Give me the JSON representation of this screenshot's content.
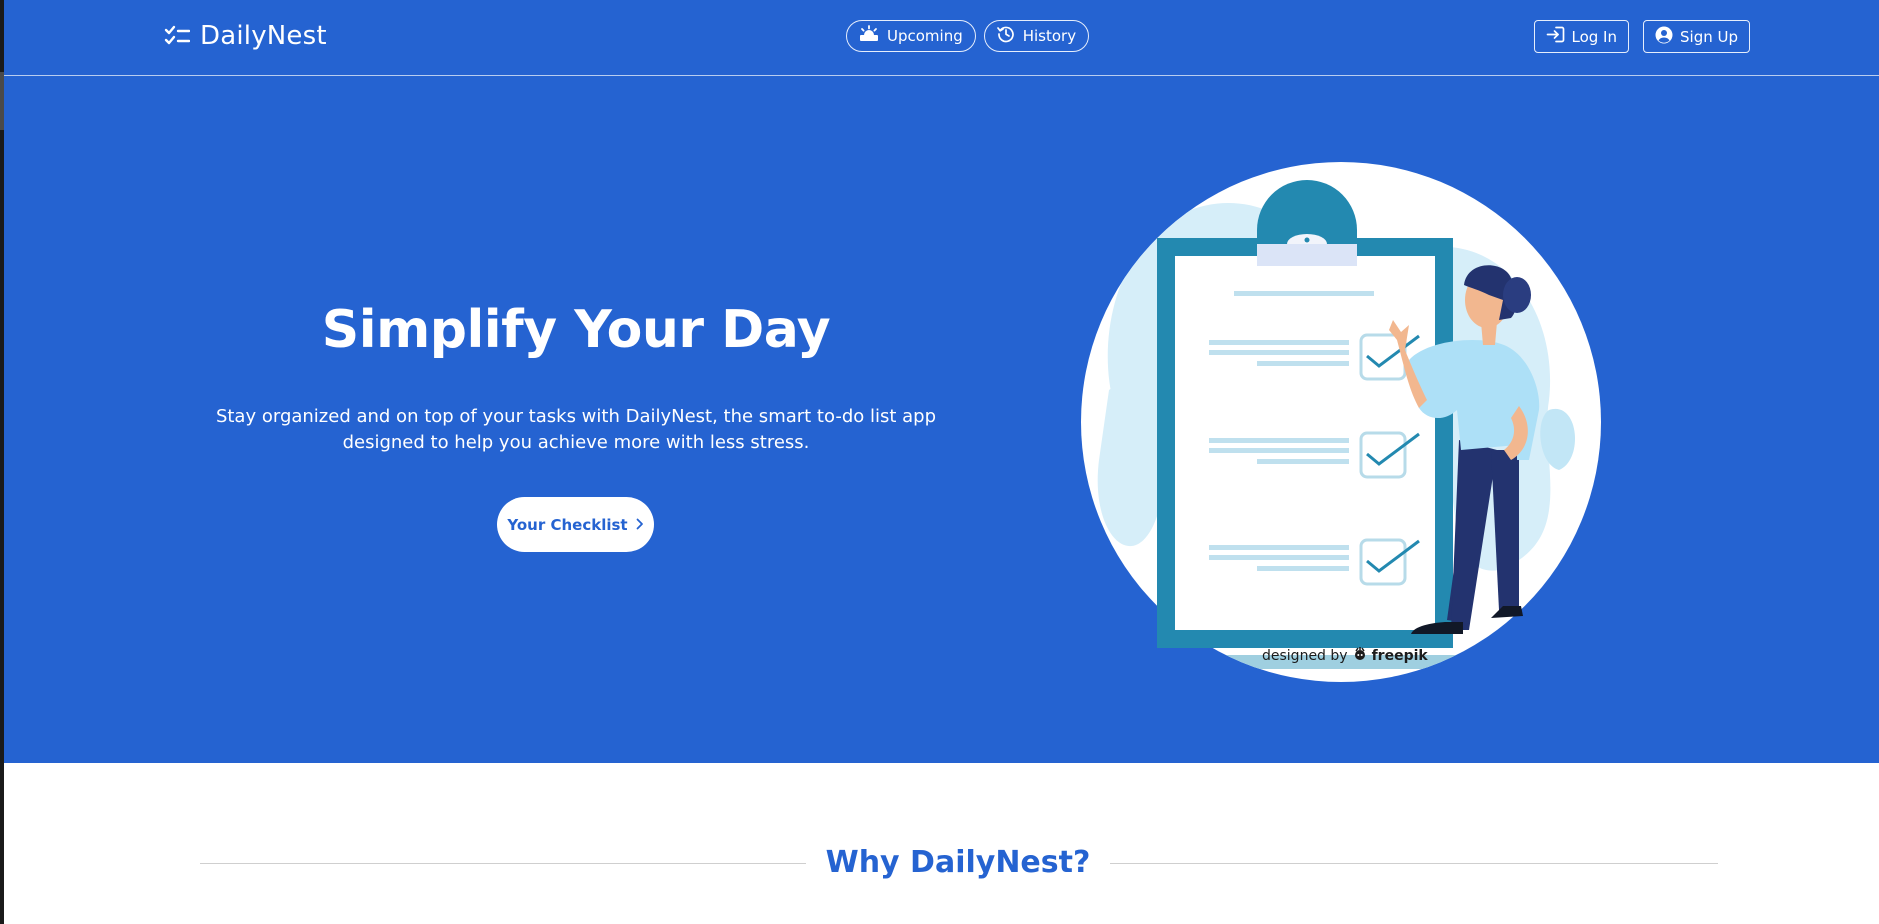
{
  "brand": {
    "name": "DailyNest"
  },
  "nav": {
    "upcoming_label": "Upcoming",
    "history_label": "History",
    "login_label": "Log In",
    "signup_label": "Sign Up"
  },
  "hero": {
    "title": "Simplify Your Day",
    "description": "Stay organized and on top of your tasks with DailyNest, the smart to-do list app designed to help you achieve more with less stress.",
    "cta_label": "Your Checklist",
    "credit_prefix": "designed by",
    "credit_brand": "freepik"
  },
  "section": {
    "title": "Why DailyNest?"
  },
  "icons": {
    "brand": "checklist-icon",
    "upcoming": "sunrise-icon",
    "history": "history-icon",
    "login": "login-icon",
    "signup": "user-circle-icon",
    "cta": "chevron-right-icon"
  },
  "colors": {
    "primary": "#2563d1",
    "illustration_teal": "#2389b0",
    "illustration_light": "#d6eef9",
    "person_shirt": "#ade0f7",
    "person_pants": "#23336f"
  }
}
